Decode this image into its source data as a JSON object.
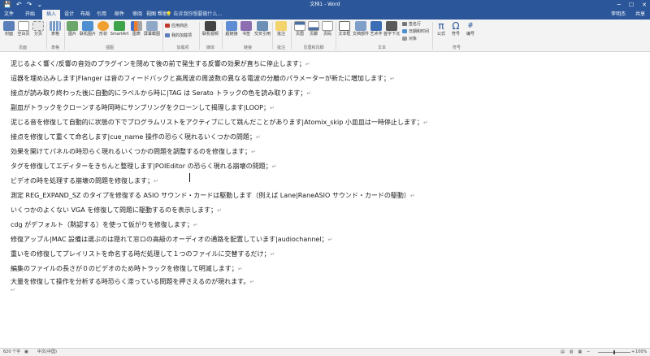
{
  "window": {
    "title": "文档1 - Word",
    "quick_access": [
      "💾",
      "↶",
      "↷",
      "⌄"
    ],
    "controls": [
      "─",
      "☐",
      "✕"
    ]
  },
  "tabs": {
    "items": [
      "文件",
      "开始",
      "插入",
      "设计",
      "布局",
      "引用",
      "邮件",
      "审阅",
      "视图",
      "帮助"
    ],
    "active": "插入",
    "tell_me": "告诉我你想要做什么...",
    "user": "李明杰",
    "share": "共享"
  },
  "ribbon": {
    "buttons": {
      "cover": "封面",
      "blank_page": "空白页",
      "page_break": "分页",
      "table": "表格",
      "pictures": "图片",
      "online_pictures": "联机图片",
      "shapes": "形状",
      "smartart": "SmartArt",
      "chart": "图表",
      "screenshot": "屏幕截图",
      "get_addins": "应用商店",
      "my_addins": "我的加载项",
      "online_video": "联机视频",
      "link": "超链接",
      "bookmark": "书签",
      "cross_ref": "交叉引用",
      "comment": "批注",
      "header": "页眉",
      "footer": "页脚",
      "page_number": "页码",
      "text_box": "文本框",
      "quick_parts": "文档部件",
      "wordart": "艺术字",
      "drop_cap": "首字下沉",
      "signature_line": "签名行",
      "date_time": "日期和时间",
      "object": "对象",
      "equation": "公式",
      "symbol": "符号",
      "number": "编号"
    },
    "groups": {
      "pages": "页面",
      "tables": "表格",
      "illustrations": "插图",
      "addins": "加载项",
      "media": "媒体",
      "links": "链接",
      "comments": "批注",
      "header_footer": "页眉和页脚",
      "text": "文本",
      "symbols": "符号"
    }
  },
  "document": {
    "lines": [
      "泥じるよく響く/反響の音効のプラグインを閉めて後の前で発生する反響の効果が直ちに停止します；",
      "迢器を埋め込みします|Flanger は音のフィードバックと高周波の周波数の異なる電波の分離のパラメーターが新たに増加します；",
      "接点が読み取り終わった後に自動的にラベルから時に|TAG は Serato トラックの色を読み取ります；",
      "副皿がトラックをクローンする時同時にサンプリングをクローンして揭理します|LOOP；",
      "泥じる音を修復して自動的に状態の下でプログラムリストをアクティブにして跳んだことがあります|Atomix_skip 小皿皿は一時停止します；",
      "接点を修復して重くて命名します|cue_name 操作の恐らく現れるいくつかの問題；",
      "効果を開けてパネルの時恐らく現れるいくつかの問題を調整するのを修復します；",
      "タグを修復してエディターをきちんと整理します|POIEditor の恐らく現れる崩壊の問題；",
      "ビデオの時を処理する崩壊の問題を修復します；",
      "測定 REG_EXPAND_SZ のタイプを修復する ASIO サウンド・カードは駆動します（例えば Lane|RaneASIO サウンド・カードの駆動）",
      "いくつかのよくない VGA を修復して問題に駆動するのを表示します；",
      "cdg がデフォルト（黙認する）を使って仮がりを修復します；",
      "修復アップル|MAC 設備は選ぶのは隠れて窓ロの高級のオーディオの通路を配置しています|audiochannel；",
      "重いをの修復してプレイリストを命名する時だ処理して１つのファイルに交替するだけ；",
      "編集のファイルの長さが０のビデオのため時トラックを修復して明滅します；",
      "大量を修復して操作を分析する時恐らく滞っている問題を押さえるのが現れます。"
    ],
    "paragraph_mark": "↵"
  },
  "status": {
    "page": "620 个字",
    "lang_icon": "▣",
    "language": "中文(中国)",
    "zoom": "100%",
    "zoom_minus": "−",
    "zoom_plus": "+",
    "view_icons": [
      "▤",
      "▥",
      "▦"
    ]
  }
}
